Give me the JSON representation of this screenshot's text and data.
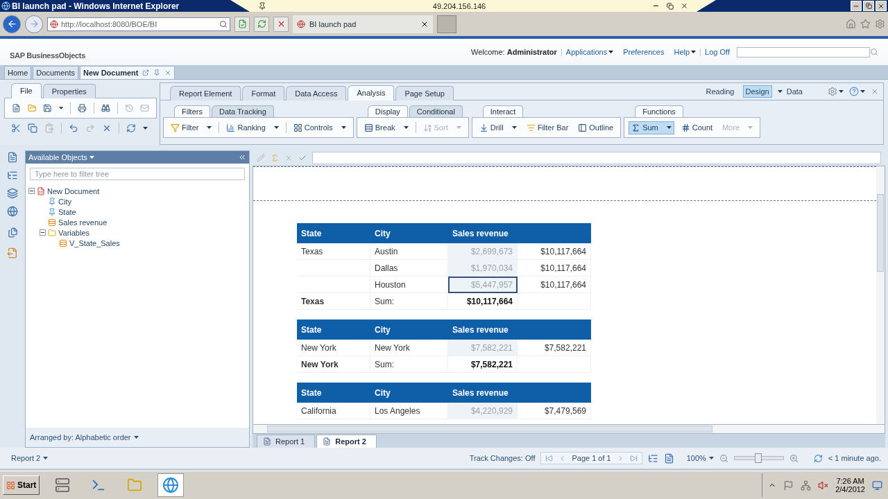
{
  "browser": {
    "title": "BI launch pad - Windows Internet Explorer",
    "remote_host": "49.204.156.146",
    "address": "http://localhost:8080/BOE/BI",
    "tab": "BI launch pad"
  },
  "header": {
    "logo": "SAP BusinessObjects",
    "welcome_label": "Welcome:",
    "user": "Administrator",
    "links": [
      {
        "label": "Applications",
        "dropdown": true
      },
      {
        "label": "Preferences",
        "dropdown": false
      },
      {
        "label": "Help",
        "dropdown": true
      },
      {
        "label": "Log Off",
        "dropdown": false
      }
    ]
  },
  "doc_tabs": [
    {
      "label": "Home",
      "selected": false
    },
    {
      "label": "Documents",
      "selected": false
    },
    {
      "label": "New Document",
      "selected": true
    }
  ],
  "ribbon": {
    "left_tabs": [
      {
        "label": "File",
        "selected": true
      },
      {
        "label": "Properties",
        "selected": false
      }
    ],
    "main_tabs": [
      {
        "label": "Report Element",
        "selected": false
      },
      {
        "label": "Format",
        "selected": false
      },
      {
        "label": "Data Access",
        "selected": false
      },
      {
        "label": "Analysis",
        "selected": true
      },
      {
        "label": "Page Setup",
        "selected": false
      }
    ],
    "modes": [
      {
        "label": "Reading",
        "selected": false
      },
      {
        "label": "Design",
        "selected": true
      },
      {
        "label": "Data",
        "selected": false
      }
    ],
    "groups": [
      {
        "tabs": [
          {
            "label": "Filters",
            "selected": true
          },
          {
            "label": "Data Tracking",
            "selected": false
          }
        ],
        "tools": [
          {
            "label": "Filter",
            "kind": "filter",
            "dropdown": true,
            "disabled": false,
            "selected": false
          },
          {
            "label": "Ranking",
            "kind": "ranking",
            "dropdown": true,
            "disabled": false,
            "selected": false
          },
          {
            "label": "Controls",
            "kind": "controls",
            "dropdown": true,
            "disabled": false,
            "selected": false
          }
        ]
      },
      {
        "tabs": [
          {
            "label": "Display",
            "selected": true
          },
          {
            "label": "Conditional",
            "selected": false
          }
        ],
        "tools": [
          {
            "label": "Break",
            "kind": "break",
            "dropdown": true,
            "disabled": false,
            "selected": false
          },
          {
            "label": "Sort",
            "kind": "sort",
            "dropdown": true,
            "disabled": true,
            "selected": false
          }
        ]
      },
      {
        "tabs": [
          {
            "label": "Interact",
            "selected": true
          }
        ],
        "tools": [
          {
            "label": "Drill",
            "kind": "drill",
            "dropdown": true,
            "disabled": false,
            "selected": false
          },
          {
            "label": "Filter Bar",
            "kind": "filterbar",
            "dropdown": false,
            "disabled": false,
            "selected": false
          },
          {
            "label": "Outline",
            "kind": "outline",
            "dropdown": false,
            "disabled": false,
            "selected": false
          }
        ]
      },
      {
        "tabs": [
          {
            "label": "Functions",
            "selected": true
          }
        ],
        "tools": [
          {
            "label": "Sum",
            "kind": "sum",
            "dropdown": true,
            "disabled": false,
            "selected": true
          },
          {
            "label": "Count",
            "kind": "count",
            "dropdown": false,
            "disabled": false,
            "selected": false
          },
          {
            "label": "More",
            "kind": "more",
            "dropdown": true,
            "disabled": true,
            "selected": false
          }
        ]
      }
    ]
  },
  "left_panel": {
    "title": "Available Objects",
    "filter_placeholder": "Type here to filter tree",
    "tree": [
      {
        "label": "New Document",
        "kind": "document",
        "expanded": true,
        "children": [
          {
            "label": "City",
            "kind": "dimension"
          },
          {
            "label": "State",
            "kind": "dimension"
          },
          {
            "label": "Sales revenue",
            "kind": "measure"
          },
          {
            "label": "Variables",
            "kind": "folder",
            "expanded": true,
            "children": [
              {
                "label": "V_State_Sales",
                "kind": "measure"
              }
            ]
          }
        ]
      }
    ],
    "arranged_by": "Arranged by: Alphabetic order"
  },
  "report": {
    "blocks": [
      {
        "columns": [
          "State",
          "City",
          "Sales revenue"
        ],
        "rows": [
          {
            "kind": "detail",
            "state": "Texas",
            "city": "Austin",
            "revenue": "$2,699,673",
            "variable": "$10,117,664",
            "selected": false
          },
          {
            "kind": "detail",
            "city": "Dallas",
            "revenue": "$1,970,034",
            "variable": "$10,117,664",
            "selected": false
          },
          {
            "kind": "detail",
            "city": "Houston",
            "revenue": "$5,447,957",
            "variable": "$10,117,664",
            "selected": true
          },
          {
            "kind": "total",
            "state": "Texas",
            "city": "Sum:",
            "revenue": "$10,117,664",
            "selected": false
          }
        ]
      },
      {
        "columns": [
          "State",
          "City",
          "Sales revenue"
        ],
        "rows": [
          {
            "kind": "detail",
            "state": "New York",
            "city": "New York",
            "revenue": "$7,582,221",
            "variable": "$7,582,221",
            "selected": false
          },
          {
            "kind": "total",
            "state": "New York",
            "city": "Sum:",
            "revenue": "$7,582,221",
            "selected": false
          }
        ]
      },
      {
        "columns": [
          "State",
          "City",
          "Sales revenue"
        ],
        "rows": [
          {
            "kind": "detail",
            "state": "California",
            "city": "Los Angeles",
            "revenue": "$4,220,929",
            "variable": "$7,479,569",
            "selected": false
          }
        ]
      }
    ]
  },
  "report_tabs": [
    {
      "label": "Report 1",
      "selected": false
    },
    {
      "label": "Report 2",
      "selected": true
    }
  ],
  "status_bar": {
    "report": "Report 2",
    "track_changes": "Track Changes: Off",
    "page": "Page 1 of 1",
    "zoom": "100%",
    "zoom_slider": {
      "level": 0.47
    },
    "refresh": "< 1 minute ago."
  },
  "taskbar": {
    "start": "Start",
    "time": "7:26 AM",
    "date": "2/4/2012"
  }
}
